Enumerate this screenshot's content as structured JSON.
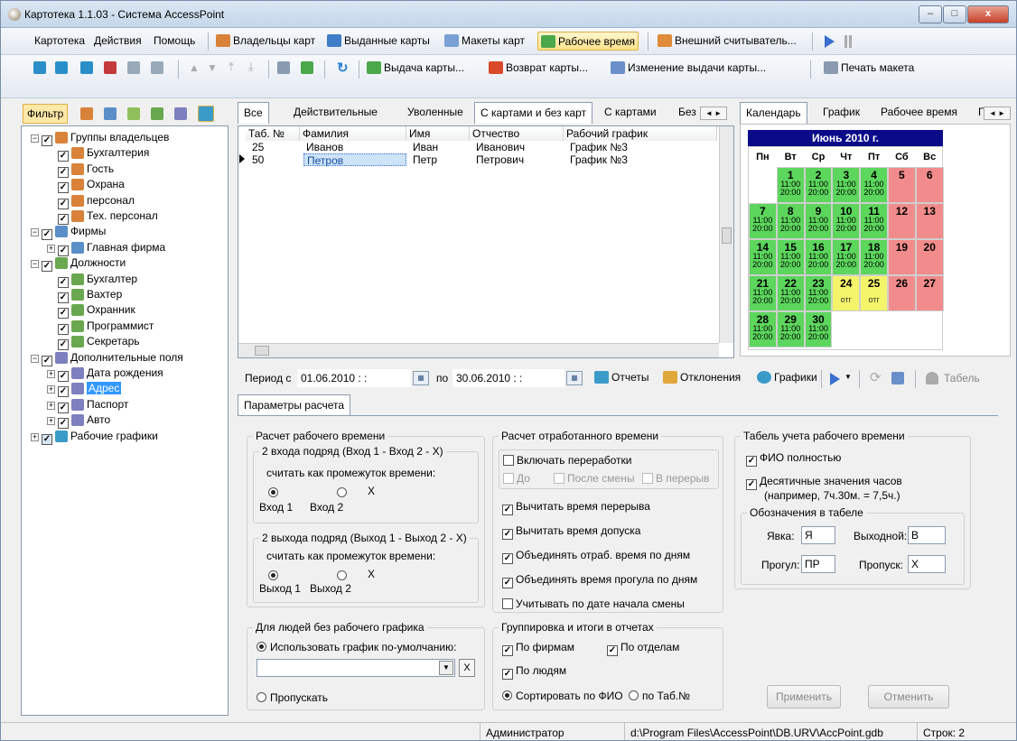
{
  "window": {
    "title": "Картотека 1.1.03 - Система AccessPoint",
    "min": "‒",
    "max": "□",
    "close": "x"
  },
  "menu": {
    "items": [
      "Картотека",
      "Действия",
      "Помощь"
    ],
    "toolbar": [
      "Владельцы карт",
      "Выданные карты",
      "Макеты карт",
      "Рабочее время",
      "Внешний считыватель..."
    ]
  },
  "toolbar2": {
    "issue": "Выдача карты...",
    "return": "Возврат карты...",
    "change": "Изменение выдачи карты...",
    "print": "Печать макета"
  },
  "left": {
    "filter": "Фильтр",
    "tree": [
      {
        "l": "Группы владельцев",
        "lvl": 0,
        "exp": "−",
        "ic": "#d9823a"
      },
      {
        "l": "Бухгалтерия",
        "lvl": 1,
        "ic": "#d9823a"
      },
      {
        "l": "Гость",
        "lvl": 1,
        "ic": "#d9823a"
      },
      {
        "l": "Охрана",
        "lvl": 1,
        "ic": "#d9823a"
      },
      {
        "l": "персонал",
        "lvl": 1,
        "ic": "#d9823a"
      },
      {
        "l": "Тех. персонал",
        "lvl": 1,
        "ic": "#d9823a"
      },
      {
        "l": "Фирмы",
        "lvl": 0,
        "exp": "−",
        "ic": "#5a8fc9"
      },
      {
        "l": "Главная фирма",
        "lvl": 1,
        "exp": "+",
        "ic": "#5a8fc9"
      },
      {
        "l": "Должности",
        "lvl": 0,
        "exp": "−",
        "ic": "#6aa84f"
      },
      {
        "l": "Бухгалтер",
        "lvl": 1,
        "ic": "#6aa84f"
      },
      {
        "l": "Вахтер",
        "lvl": 1,
        "ic": "#6aa84f"
      },
      {
        "l": "Охранник",
        "lvl": 1,
        "ic": "#6aa84f"
      },
      {
        "l": "Программист",
        "lvl": 1,
        "ic": "#6aa84f"
      },
      {
        "l": "Секретарь",
        "lvl": 1,
        "ic": "#6aa84f"
      },
      {
        "l": "Дополнительные поля",
        "lvl": 0,
        "exp": "−",
        "ic": "#7d7fbf"
      },
      {
        "l": "Дата рождения",
        "lvl": 1,
        "exp": "+",
        "ic": "#7d7fbf"
      },
      {
        "l": "Адрес",
        "lvl": 1,
        "exp": "+",
        "ic": "#7d7fbf",
        "sel": true
      },
      {
        "l": "Паспорт",
        "lvl": 1,
        "exp": "+",
        "ic": "#7d7fbf"
      },
      {
        "l": "Авто",
        "lvl": 1,
        "exp": "+",
        "ic": "#7d7fbf"
      },
      {
        "l": "Рабочие графики",
        "lvl": 0,
        "exp": "+",
        "ic": "#3a9bc9"
      }
    ]
  },
  "tabs": {
    "list": [
      "Все",
      "Действительные",
      "Уволенные",
      "С картами и без карт",
      "С картами",
      "Без"
    ]
  },
  "grid": {
    "headers": [
      "Таб. №",
      "Фамилия",
      "Имя",
      "Отчество",
      "Рабочий график"
    ],
    "rows": [
      [
        "25",
        "Иванов",
        "Иван",
        "Иванович",
        "График №3"
      ],
      [
        "50",
        "Петров",
        "Петр",
        "Петрович",
        "График №3"
      ]
    ]
  },
  "rtabs": [
    "Календарь",
    "График",
    "Рабочее время",
    "Г"
  ],
  "calendar": {
    "title": "Июнь 2010 г.",
    "days": [
      "Пн",
      "Вт",
      "Ср",
      "Чт",
      "Пт",
      "Сб",
      "Вс"
    ],
    "cells": [
      {
        "c": 1,
        "r": 0,
        "d": "1",
        "t1": "11:00",
        "t2": "20:00",
        "k": "g"
      },
      {
        "c": 2,
        "r": 0,
        "d": "2",
        "t1": "11:00",
        "t2": "20:00",
        "k": "g"
      },
      {
        "c": 3,
        "r": 0,
        "d": "3",
        "t1": "11:00",
        "t2": "20:00",
        "k": "g"
      },
      {
        "c": 4,
        "r": 0,
        "d": "4",
        "t1": "11:00",
        "t2": "20:00",
        "k": "g"
      },
      {
        "c": 5,
        "r": 0,
        "d": "5",
        "k": "r"
      },
      {
        "c": 6,
        "r": 0,
        "d": "6",
        "k": "r"
      },
      {
        "c": 0,
        "r": 1,
        "d": "7",
        "t1": "11:00",
        "t2": "20:00",
        "k": "g"
      },
      {
        "c": 1,
        "r": 1,
        "d": "8",
        "t1": "11:00",
        "t2": "20:00",
        "k": "g"
      },
      {
        "c": 2,
        "r": 1,
        "d": "9",
        "t1": "11:00",
        "t2": "20:00",
        "k": "g"
      },
      {
        "c": 3,
        "r": 1,
        "d": "10",
        "t1": "11:00",
        "t2": "20:00",
        "k": "g"
      },
      {
        "c": 4,
        "r": 1,
        "d": "11",
        "t1": "11:00",
        "t2": "20:00",
        "k": "g"
      },
      {
        "c": 5,
        "r": 1,
        "d": "12",
        "k": "r"
      },
      {
        "c": 6,
        "r": 1,
        "d": "13",
        "k": "r"
      },
      {
        "c": 0,
        "r": 2,
        "d": "14",
        "t1": "11:00",
        "t2": "20:00",
        "k": "g"
      },
      {
        "c": 1,
        "r": 2,
        "d": "15",
        "t1": "11:00",
        "t2": "20:00",
        "k": "g"
      },
      {
        "c": 2,
        "r": 2,
        "d": "16",
        "t1": "11:00",
        "t2": "20:00",
        "k": "g"
      },
      {
        "c": 3,
        "r": 2,
        "d": "17",
        "t1": "11:00",
        "t2": "20:00",
        "k": "g"
      },
      {
        "c": 4,
        "r": 2,
        "d": "18",
        "t1": "11:00",
        "t2": "20:00",
        "k": "g"
      },
      {
        "c": 5,
        "r": 2,
        "d": "19",
        "k": "r"
      },
      {
        "c": 6,
        "r": 2,
        "d": "20",
        "k": "r"
      },
      {
        "c": 0,
        "r": 3,
        "d": "21",
        "t1": "11:00",
        "t2": "20:00",
        "k": "g"
      },
      {
        "c": 1,
        "r": 3,
        "d": "22",
        "t1": "11:00",
        "t2": "20:00",
        "k": "g"
      },
      {
        "c": 2,
        "r": 3,
        "d": "23",
        "t1": "11:00",
        "t2": "20:00",
        "k": "g"
      },
      {
        "c": 3,
        "r": 3,
        "d": "24",
        "t1": "отг",
        "k": "y"
      },
      {
        "c": 4,
        "r": 3,
        "d": "25",
        "t1": "отг",
        "k": "y"
      },
      {
        "c": 5,
        "r": 3,
        "d": "26",
        "k": "r"
      },
      {
        "c": 6,
        "r": 3,
        "d": "27",
        "k": "r"
      },
      {
        "c": 0,
        "r": 4,
        "d": "28",
        "t1": "11:00",
        "t2": "20:00",
        "k": "g"
      },
      {
        "c": 1,
        "r": 4,
        "d": "29",
        "t1": "11:00",
        "t2": "20:00",
        "k": "g"
      },
      {
        "c": 2,
        "r": 4,
        "d": "30",
        "t1": "11:00",
        "t2": "20:00",
        "k": "g"
      }
    ],
    "colors": {
      "g": "#5cd65c",
      "r": "#f28b8b",
      "y": "#f4f46a"
    }
  },
  "period": {
    "from_label": "Период с",
    "from": "01.06.2010 : :",
    "to_label": "по",
    "to": "30.06.2010 : :",
    "reports": "Отчеты",
    "deviations": "Отклонения",
    "schedules": "Графики",
    "tabel": "Табель"
  },
  "params": {
    "tab": "Параметры расчета",
    "calc": {
      "title": "Расчет рабочего времени",
      "in_title": "2 входа подряд (Вход 1 - Вход 2 - X)",
      "in_q": "считать как промежуток времени:",
      "in1": "Вход 1",
      "in2": "Вход 2",
      "inx": "X",
      "out_title": "2 выхода подряд (Выход 1 - Выход 2 - X)",
      "out_q": "считать как промежуток времени:",
      "out1": "Выход 1",
      "out2": "Выход 2",
      "outx": "X"
    },
    "worked": {
      "title": "Расчет отработанного времени",
      "overtime": "Включать переработки",
      "before": "До",
      "after": "После смены",
      "break": "В перерыв",
      "opts": [
        "Вычитать время перерыва",
        "Вычитать время допуска",
        "Объединять отраб. время по дням",
        "Объединять время прогула по дням",
        "Учитывать по дате начала смены"
      ]
    },
    "tabel": {
      "title": "Табель учета рабочего времени",
      "fio": "ФИО полностью",
      "dec": "Десятичные значения часов",
      "dec_ex": "(например, 7ч.30м. = 7,5ч.)",
      "marks_title": "Обозначения в табеле",
      "presence": "Явка:",
      "presence_v": "Я",
      "dayoff": "Выходной:",
      "dayoff_v": "В",
      "absent": "Прогул:",
      "absent_v": "ПР",
      "skip": "Пропуск:",
      "skip_v": "Х"
    },
    "nosched": {
      "title": "Для людей без рабочего графика",
      "use_default": "Использовать график по-умолчанию:",
      "skip": "Пропускать",
      "x": "X"
    },
    "group": {
      "title": "Группировка и итоги в отчетах",
      "firms": "По фирмам",
      "depts": "По отделам",
      "people": "По людям",
      "sort_fio": "Сортировать по ФИО",
      "sort_tab": "по Таб.№"
    },
    "apply": "Применить",
    "cancel": "Отменить"
  },
  "status": {
    "user": "Администратор",
    "db": "d:\\Program Files\\AccessPoint\\DB.URV\\AccPoint.gdb",
    "rows": "Строк: 2"
  }
}
